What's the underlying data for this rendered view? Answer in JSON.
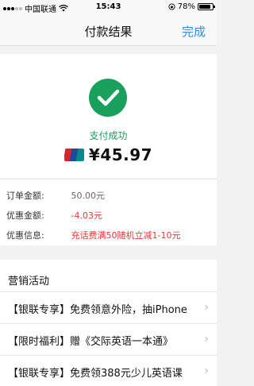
{
  "status_bar": {
    "carrier": "中国联通",
    "time": "15:43",
    "battery": "78%"
  },
  "nav": {
    "title": "付款结果",
    "done_label": "完成"
  },
  "result": {
    "status_text": "支付成功",
    "amount": "¥45.97",
    "brand_icon": "unionpay-icon"
  },
  "details": [
    {
      "label": "订单金额:",
      "value": "50.00元",
      "color": "#666666"
    },
    {
      "label": "优惠金额:",
      "value": "-4.03元",
      "color": "#e53935"
    },
    {
      "label": "优惠信息:",
      "value": "充话费满50随机立减1-10元",
      "color": "#e53935"
    }
  ],
  "promotions": {
    "title": "营销活动",
    "items": [
      {
        "text": "【银联专享】免费领意外险，抽iPhone"
      },
      {
        "text": "【限时福利】赠《交际英语一本通》"
      },
      {
        "text": "【银联专享】免费领388元少儿英语课"
      }
    ]
  },
  "colors": {
    "success": "#18a05c",
    "accent": "#2d8cf0",
    "discount": "#e53935"
  }
}
